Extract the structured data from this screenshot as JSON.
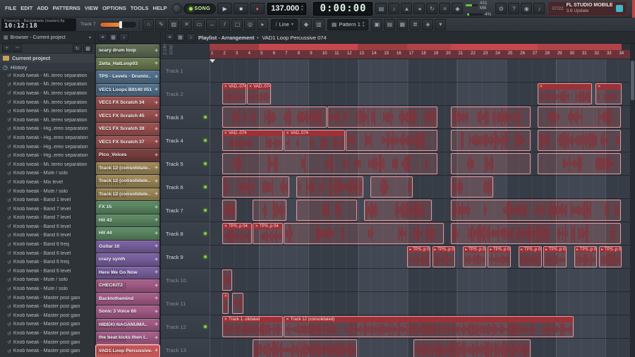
{
  "menu": [
    "FILE",
    "EDIT",
    "ADD",
    "PATTERNS",
    "VIEW",
    "OPTIONS",
    "TOOLS",
    "HELP"
  ],
  "transport": {
    "mode": "SONG",
    "tempo": "137.000",
    "time": "0:00:00"
  },
  "system": {
    "memory": "431 MB",
    "cpu": "4%"
  },
  "notification": {
    "date": "07/22",
    "title": "FL STUDIO MOBILE",
    "subtitle": "3.6 Update"
  },
  "titlebar": {
    "project": "Freestyle - Backstreets (master).flp",
    "clock": "10:12:18",
    "track_label": "Track 7"
  },
  "tools": {
    "tool_dropdown": "Line",
    "pattern": "Pattern 1"
  },
  "icons": {
    "row1": [
      {
        "n": "typing-keyboard-icon",
        "g": "▤"
      },
      {
        "n": "piano-keyboard-icon",
        "g": "♪"
      },
      {
        "n": "metronome-icon",
        "g": "▲"
      },
      {
        "n": "countdown-icon",
        "g": "◂"
      },
      {
        "n": "loop-record-icon",
        "g": "↻"
      },
      {
        "n": "step-edit-icon",
        "g": "≡"
      },
      {
        "n": "multilink-icon",
        "g": "◆"
      }
    ],
    "row1b": [
      {
        "n": "settings-gear-icon",
        "g": "⚙"
      },
      {
        "n": "help-icon",
        "g": "?"
      },
      {
        "n": "about-icon",
        "g": "◉"
      },
      {
        "n": "master-audio-icon",
        "g": "♪"
      }
    ],
    "row2": [
      {
        "n": "snap-magnet-icon",
        "g": "∩"
      },
      {
        "n": "draw-tool-icon",
        "g": "✎"
      },
      {
        "n": "paint-tool-icon",
        "g": "▨"
      },
      {
        "n": "delete-tool-icon",
        "g": "✕"
      },
      {
        "n": "mute-tool-icon",
        "g": "▭"
      },
      {
        "n": "slip-tool-icon",
        "g": "↔"
      },
      {
        "n": "slice-tool-icon",
        "g": "/"
      },
      {
        "n": "select-tool-icon",
        "g": "▢"
      },
      {
        "n": "zoom-tool-icon",
        "g": "◎"
      },
      {
        "n": "preview-tool-icon",
        "g": "▸"
      }
    ],
    "row2b": [
      {
        "n": "marker-add-icon",
        "g": "◆"
      },
      {
        "n": "grid-color-icon",
        "g": "▥"
      }
    ],
    "row2c": [
      {
        "n": "arrangement-picker-icon",
        "g": "▣"
      },
      {
        "n": "clip-source-icon",
        "g": "▤"
      },
      {
        "n": "film-strip-icon",
        "g": "▦"
      },
      {
        "n": "stack-icon",
        "g": "≣"
      },
      {
        "n": "performance-mode-icon",
        "g": "◈"
      },
      {
        "n": "more-options-icon",
        "g": "▾"
      }
    ],
    "browser_tools": [
      {
        "n": "expand-icon",
        "g": "+"
      },
      {
        "n": "collapse-all-icon",
        "g": "−"
      }
    ],
    "browser_right": [
      {
        "n": "refresh-icon",
        "g": "↻"
      },
      {
        "n": "browser-view-icon",
        "g": "▦"
      }
    ],
    "picker_icons": [
      {
        "n": "drag-handle-icon",
        "g": "≡"
      },
      {
        "n": "picker-filter-icon",
        "g": "▦"
      },
      {
        "n": "picker-audio-icon",
        "g": "♪"
      }
    ],
    "playlist_icons": [
      {
        "n": "playlist-menu-icon",
        "g": "≡"
      },
      {
        "n": "playlist-grid-icon",
        "g": "▦"
      },
      {
        "n": "audition-speaker-icon",
        "g": "♪"
      }
    ]
  },
  "browser": {
    "header": "Browser - Current project",
    "root": "Current project",
    "selected": "History",
    "history": [
      "Knob tweak - Mi..tereo separation",
      "Knob tweak - Mi..tereo separation",
      "Knob tweak - Mi..tereo separation",
      "Knob tweak - Mi..tereo separation",
      "Knob tweak - Mi..tereo separation",
      "Knob tweak - Mi..tereo separation",
      "Knob tweak - Hig..ereo separation",
      "Knob tweak - Hig..ereo separation",
      "Knob tweak - Hig..ereo separation",
      "Knob tweak - Hig..ereo separation",
      "Knob tweak - Mi..tereo separation",
      "Knob tweak - Mute / solo",
      "Knob tweak - Mix level",
      "Knob tweak - Mute / solo",
      "Knob tweak - Band 1 level",
      "Knob tweak - Band 7 level",
      "Knob tweak - Band 7 level",
      "Knob tweak - Band 6 level",
      "Knob tweak - Band 6 level",
      "Knob tweak - Band 6 freq",
      "Knob tweak - Band 6 level",
      "Knob tweak - Band 6 freq",
      "Knob tweak - Band 6 level",
      "Knob tweak - Mute / solo",
      "Knob tweak - Mute / solo",
      "Knob tweak - Master post gain",
      "Knob tweak - Master post gain",
      "Knob tweak - Master post gain",
      "Knob tweak - Master post gain",
      "Knob tweak - Master post gain",
      "Knob tweak - Master post gain",
      "Knob tweak - Master post gain"
    ]
  },
  "picker": [
    {
      "name": "scary drum loop",
      "color": "#5f6d55",
      "wave": true
    },
    {
      "name": "Zetta_HatLoop03",
      "color": "#6e7c52",
      "wave": false
    },
    {
      "name": "TPS - Levels - Drumlo..",
      "color": "#54738e",
      "wave": false
    },
    {
      "name": "VEC1 Loops B8140 051",
      "color": "#54738e",
      "wave": true
    },
    {
      "name": "VEC1 FX Scratch 34",
      "color": "#9c5252",
      "wave": false
    },
    {
      "name": "VEC1 FX Scratch 45",
      "color": "#9c5252",
      "wave": false
    },
    {
      "name": "VEC1 FX Scratch 38",
      "color": "#9c5252",
      "wave": false
    },
    {
      "name": "VEC1 FX Scratch 37",
      "color": "#9c5252",
      "wave": false
    },
    {
      "name": "Pico_Voices",
      "color": "#7a4040",
      "wave": false
    },
    {
      "name": "Track 12 (consolidate..",
      "color": "#a08a58",
      "wave": true
    },
    {
      "name": "Track 12 (consolidate..",
      "color": "#a08a58",
      "wave": true
    },
    {
      "name": "Track 12 (consolidate..",
      "color": "#a08a58",
      "wave": true
    },
    {
      "name": "FX 15",
      "color": "#5d8a64",
      "wave": false
    },
    {
      "name": "Hit 43",
      "color": "#5d8a64",
      "wave": false
    },
    {
      "name": "Hit 44",
      "color": "#5d8a64",
      "wave": false
    },
    {
      "name": "Guitar 10",
      "color": "#7c62a2",
      "wave": false
    },
    {
      "name": "crazy synth",
      "color": "#7c62a2",
      "wave": false
    },
    {
      "name": "Here We Go Now",
      "color": "#7c62a2",
      "wave": true
    },
    {
      "name": "CHECKIT2",
      "color": "#a65e8a",
      "wave": true
    },
    {
      "name": "Backtothemind",
      "color": "#a65e8a",
      "wave": false
    },
    {
      "name": "Sonic 3 Voice 60",
      "color": "#a65e8a",
      "wave": false
    },
    {
      "name": "HIDEKI NAGANUMA..",
      "color": "#a65e8a",
      "wave": true
    },
    {
      "name": "the beat kicks then I..",
      "color": "#a65e8a",
      "wave": true
    },
    {
      "name": "VAD1 Loop Percussive..",
      "color": "#c25555",
      "wave": true,
      "selected": true
    }
  ],
  "playlist": {
    "header": "Playlist - Arrangement",
    "selection": "VAD1 Loop Percussive 074",
    "side_labels": [
      "Z-CROSS",
      "STRETCH"
    ],
    "bars": 34,
    "tracks": [
      {
        "name": "Track 1",
        "dim": true,
        "led": false
      },
      {
        "name": "Track 2",
        "dim": true,
        "led": false
      },
      {
        "name": "Track 3",
        "dim": false,
        "led": true
      },
      {
        "name": "Track 4",
        "dim": false,
        "led": true
      },
      {
        "name": "Track 5",
        "dim": false,
        "led": true
      },
      {
        "name": "Track 6",
        "dim": false,
        "led": true
      },
      {
        "name": "Track 7",
        "dim": false,
        "led": true
      },
      {
        "name": "Track 8",
        "dim": false,
        "led": true
      },
      {
        "name": "Track 9",
        "dim": false,
        "led": true
      },
      {
        "name": "Track 10",
        "dim": true,
        "led": false
      },
      {
        "name": "Track 11",
        "dim": true,
        "led": false
      },
      {
        "name": "Track 12",
        "dim": true,
        "led": true
      },
      {
        "name": "Track 13",
        "dim": true,
        "led": false
      }
    ],
    "markers": [
      {
        "s": 1,
        "l": 4,
        "c": "#9c3d42"
      },
      {
        "s": 5,
        "l": 8,
        "c": "#c4484e"
      },
      {
        "s": 13,
        "l": 4,
        "c": "#9c3d42"
      },
      {
        "s": 17,
        "l": 3.5,
        "c": "#b04348"
      },
      {
        "s": 20.5,
        "l": 7,
        "c": "#c4484e"
      },
      {
        "s": 27.5,
        "l": 6.8,
        "c": "#b04348"
      }
    ],
    "clips": [
      {
        "t": 2,
        "s": 2,
        "l": 2,
        "kind": "wave",
        "label": "VAD..074",
        "x": true
      },
      {
        "t": 2,
        "s": 4,
        "l": 2,
        "kind": "wave",
        "label": "VAD..074",
        "x": true
      },
      {
        "t": 2,
        "s": 27.5,
        "l": 4.5,
        "kind": "wave",
        "x": true
      },
      {
        "t": 2,
        "s": 32.2,
        "l": 2.2,
        "kind": "wave",
        "x": true
      },
      {
        "t": 3,
        "s": 2,
        "l": 8.5,
        "kind": "chops"
      },
      {
        "t": 3,
        "s": 10.5,
        "l": 9,
        "kind": "chops"
      },
      {
        "t": 3,
        "s": 20.5,
        "l": 6.5,
        "kind": "chops"
      },
      {
        "t": 3,
        "s": 27.5,
        "l": 6.8,
        "kind": "chops"
      },
      {
        "t": 4,
        "s": 2,
        "l": 5,
        "kind": "chops",
        "label": "VAD..074",
        "x": true
      },
      {
        "t": 4,
        "s": 7,
        "l": 5,
        "kind": "chops",
        "label": "VAD..074",
        "x": true
      },
      {
        "t": 4,
        "s": 12,
        "l": 7.5,
        "kind": "chops"
      },
      {
        "t": 4,
        "s": 20.5,
        "l": 6.5,
        "kind": "chops"
      },
      {
        "t": 4,
        "s": 27.5,
        "l": 6.8,
        "kind": "chops"
      },
      {
        "t": 5,
        "s": 2,
        "l": 17.5,
        "kind": "sparse"
      },
      {
        "t": 5,
        "s": 20.5,
        "l": 6.5,
        "kind": "sparse"
      },
      {
        "t": 5,
        "s": 27.5,
        "l": 6.8,
        "kind": "sparse"
      },
      {
        "t": 6,
        "s": 2,
        "l": 5.5,
        "kind": "chops"
      },
      {
        "t": 6,
        "s": 8,
        "l": 5.5,
        "kind": "chops"
      },
      {
        "t": 6,
        "s": 14,
        "l": 3.5,
        "kind": "sparse"
      },
      {
        "t": 6,
        "s": 20.5,
        "l": 3.5,
        "kind": "sparse"
      },
      {
        "t": 7,
        "s": 2,
        "l": 1.2,
        "kind": "wave"
      },
      {
        "t": 7,
        "s": 4.5,
        "l": 2.8,
        "kind": "sparse"
      },
      {
        "t": 7,
        "s": 8,
        "l": 5,
        "kind": "sparse"
      },
      {
        "t": 7,
        "s": 13.5,
        "l": 5.5,
        "kind": "sparse"
      },
      {
        "t": 7,
        "s": 20.5,
        "l": 13.8,
        "kind": "chops"
      },
      {
        "t": 8,
        "s": 2,
        "l": 2.5,
        "kind": "wave",
        "label": "TPS..p 04",
        "x": true
      },
      {
        "t": 8,
        "s": 4.5,
        "l": 2.5,
        "kind": "wave",
        "label": "TPS..p 04",
        "x": true
      },
      {
        "t": 8,
        "s": 7,
        "l": 13,
        "kind": "chops"
      },
      {
        "t": 8,
        "s": 20.5,
        "l": 13.8,
        "kind": "chops"
      },
      {
        "t": 9,
        "s": 17,
        "l": 1.9,
        "kind": "wave",
        "label": "TPS..p 04",
        "arrow": true
      },
      {
        "t": 9,
        "s": 19,
        "l": 1.9,
        "kind": "wave",
        "label": "TPS..p 04",
        "arrow": true
      },
      {
        "t": 9,
        "s": 21.5,
        "l": 1.9,
        "kind": "wave",
        "label": "TPS..p 04",
        "arrow": true
      },
      {
        "t": 9,
        "s": 23.5,
        "l": 1.9,
        "kind": "wave",
        "label": "TPS..p 04",
        "arrow": true
      },
      {
        "t": 9,
        "s": 26,
        "l": 1.9,
        "kind": "wave",
        "label": "TPS..p 04",
        "arrow": true
      },
      {
        "t": 9,
        "s": 28,
        "l": 1.9,
        "kind": "wave",
        "label": "TPS..p 04",
        "arrow": true
      },
      {
        "t": 9,
        "s": 30.5,
        "l": 1.9,
        "kind": "wave",
        "label": "TPS..p 04",
        "arrow": true
      },
      {
        "t": 9,
        "s": 32.5,
        "l": 1.9,
        "kind": "wave",
        "label": "TPS..p 04",
        "arrow": true
      },
      {
        "t": 10,
        "s": 2,
        "l": 0.9,
        "kind": "wave"
      },
      {
        "t": 11,
        "s": 2,
        "l": 0.6,
        "kind": "wave",
        "x": true
      },
      {
        "t": 11,
        "s": 2.8,
        "l": 1,
        "kind": "wave"
      },
      {
        "t": 12,
        "s": 2,
        "l": 5,
        "kind": "wave",
        "label": "Track 1..olidated",
        "x": true
      },
      {
        "t": 12,
        "s": 7,
        "l": 23.5,
        "kind": "wave",
        "label": "Track 12 (consolidated)",
        "x": true
      },
      {
        "t": 13,
        "s": 4.5,
        "l": 8.5,
        "kind": "wave"
      },
      {
        "t": 13,
        "s": 17.5,
        "l": 9.5,
        "kind": "wave"
      }
    ]
  }
}
